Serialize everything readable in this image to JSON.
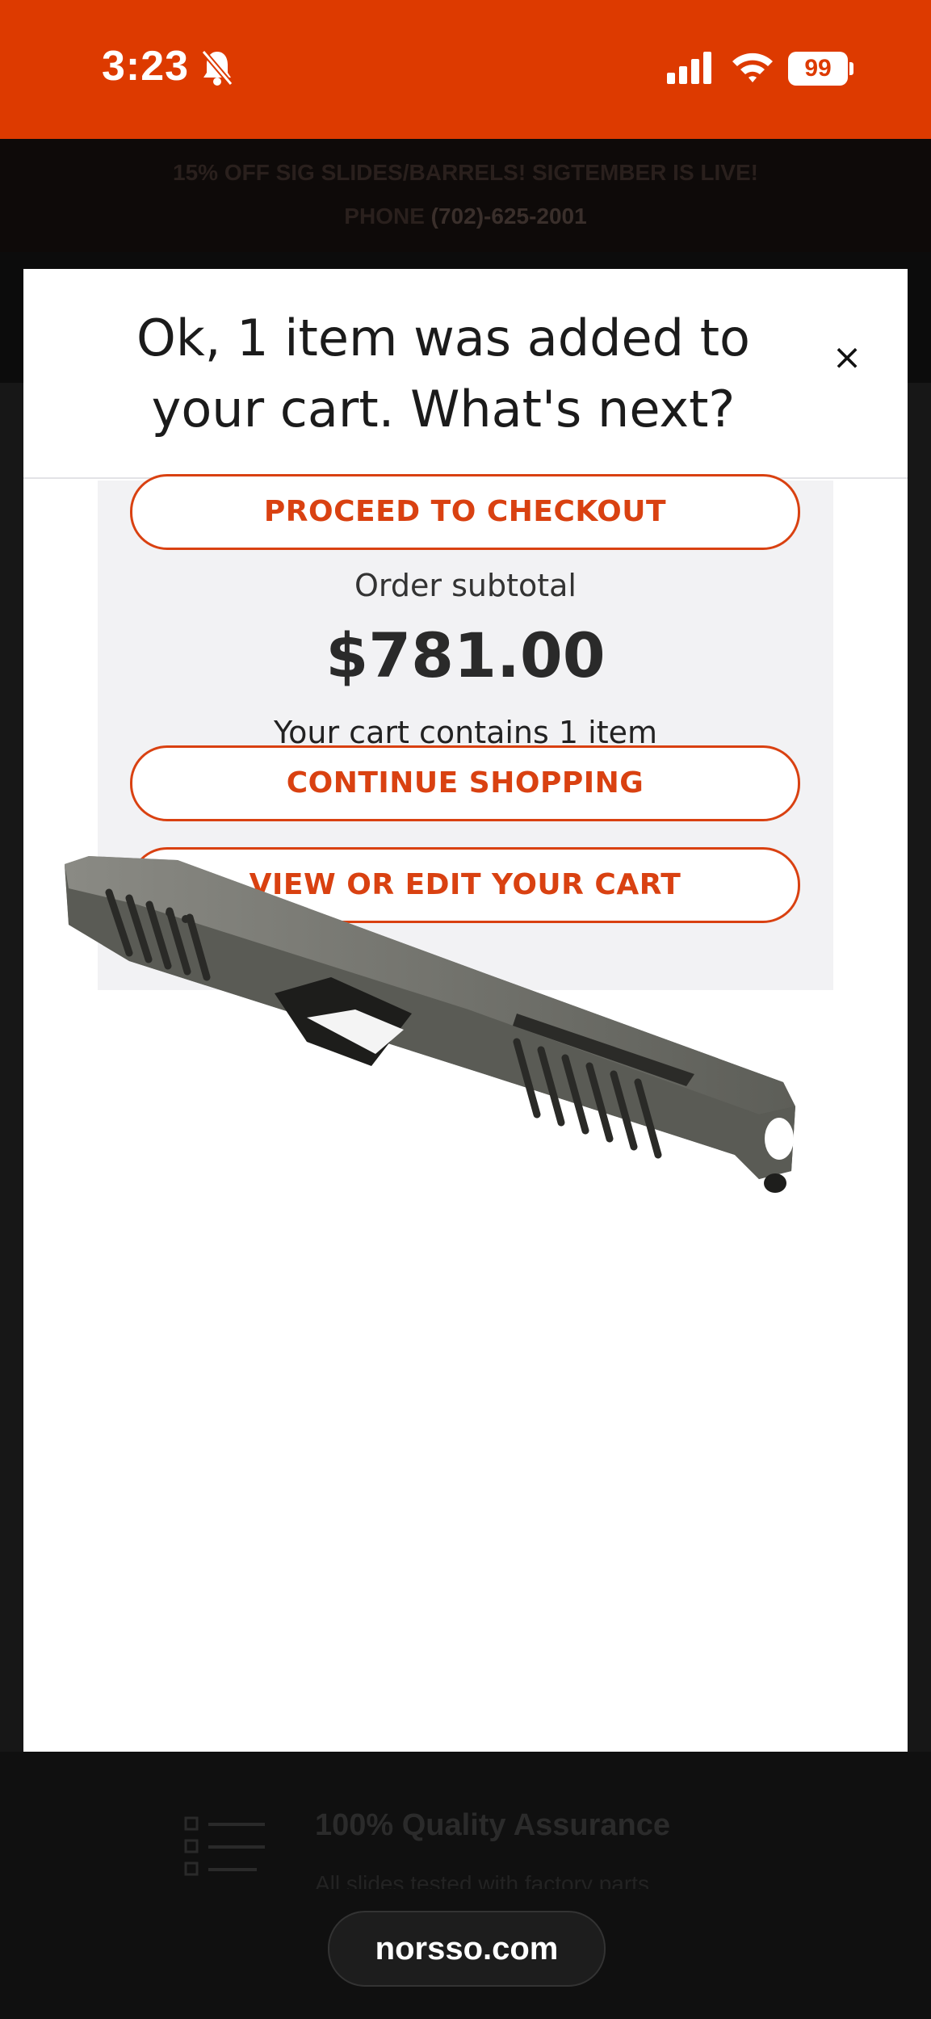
{
  "status_bar": {
    "time": "3:23",
    "battery": "99"
  },
  "promo": {
    "line1": "15% OFF SIG SLIDES/BARRELS! SIGTEMBER IS LIVE!",
    "phone_label": "PHONE",
    "phone_number": "(702)-625-2001"
  },
  "modal": {
    "title": "Ok, 1 item was added to your cart. What's next?",
    "close_symbol": "×",
    "checkout_label": "PROCEED TO CHECKOUT",
    "subtotal_label": "Order subtotal",
    "subtotal_value": "$781.00",
    "cart_count_text": "Your cart contains 1 item",
    "continue_label": "CONTINUE SHOPPING",
    "view_cart_label": "VIEW OR EDIT YOUR CART"
  },
  "feature": {
    "title": "100% Quality Assurance",
    "desc": "All slides tested with factory parts"
  },
  "browser": {
    "url": "norsso.com"
  },
  "colors": {
    "brand": "#dd3a00",
    "button_accent": "#d94111"
  }
}
